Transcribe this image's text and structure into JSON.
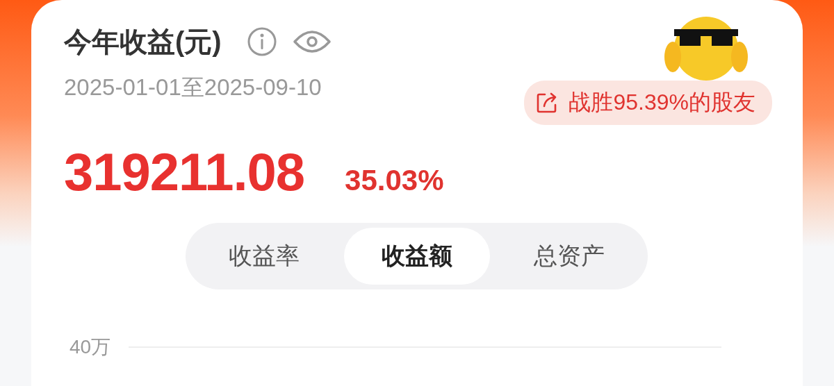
{
  "header": {
    "title": "今年收益(元)",
    "date_range": "2025-01-01至2025-09-10"
  },
  "rank_badge": {
    "text": "战胜95.39%的股友"
  },
  "summary": {
    "amount": "319211.08",
    "rate": "35.03%"
  },
  "tabs": [
    {
      "label": "收益率",
      "selected": false
    },
    {
      "label": "收益额",
      "selected": true
    },
    {
      "label": "总资产",
      "selected": false
    }
  ],
  "chart": {
    "y_tick": "40万"
  }
}
